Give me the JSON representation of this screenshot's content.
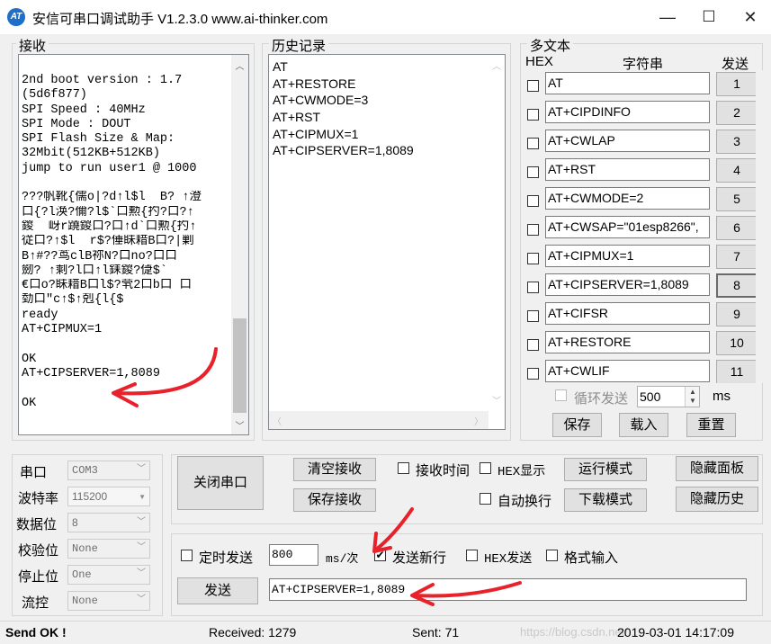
{
  "window": {
    "title": "安信可串口调试助手 V1.2.3.0    www.ai-thinker.com",
    "icon_text": "AT",
    "minimize": "—",
    "maximize": "☐",
    "close": "✕"
  },
  "receive": {
    "label": "接收",
    "lines": [
      "2nd boot version : 1.7",
      "(5d6f877)",
      "SPI Speed : 40MHz",
      "SPI Mode : DOUT",
      "SPI Flash Size & Map:",
      "32Mbit(512KB+512KB)",
      "jump to run user1 @ 1000",
      "",
      "???帆靴{儒o|?d↑l$l  B? ↑澄",
      "口{?l涣?儞?l$`口勲{扚?口?↑",
      "鍐  岈r蹺鍐口?口↑d`口勲{扚↑",
      "従口?↑$l  r$?倕眛耤B口?|剿",
      "B↑#??茑clB祢N?口no?口口",
      "劒? ↑剩?l口↑l銇鍐?偼$`",
      "€口o?眛耤B口l$?茕2口b口 口",
      "勎口\"c↑$↑剋{l{$",
      "ready",
      "AT+CIPMUX=1",
      "",
      "OK",
      "AT+CIPSERVER=1,8089",
      "",
      "OK"
    ]
  },
  "history": {
    "label": "历史记录",
    "items": [
      "AT",
      "AT+RESTORE",
      "AT+CWMODE=3",
      "AT+RST",
      "AT+CIPMUX=1",
      "AT+CIPSERVER=1,8089"
    ]
  },
  "multitext": {
    "label": "多文本",
    "col_hex": "HEX",
    "col_string": "字符串",
    "col_send": "发送",
    "rows": [
      {
        "text": "AT",
        "btn": "1"
      },
      {
        "text": "AT+CIPDINFO",
        "btn": "2"
      },
      {
        "text": "AT+CWLAP",
        "btn": "3"
      },
      {
        "text": "AT+RST",
        "btn": "4"
      },
      {
        "text": "AT+CWMODE=2",
        "btn": "5"
      },
      {
        "text": "AT+CWSAP=\"01esp8266\",",
        "btn": "6"
      },
      {
        "text": "AT+CIPMUX=1",
        "btn": "7"
      },
      {
        "text": "AT+CIPSERVER=1,8089",
        "btn": "8"
      },
      {
        "text": "AT+CIFSR",
        "btn": "9"
      },
      {
        "text": "AT+RESTORE",
        "btn": "10"
      },
      {
        "text": "AT+CWLIF",
        "btn": "11"
      }
    ],
    "loop_label": "循环发送",
    "loop_value": "500",
    "loop_unit": "ms",
    "save": "保存",
    "load": "载入",
    "reset": "重置"
  },
  "serial": {
    "port_label": "串口",
    "port_value": "COM3",
    "baud_label": "波特率",
    "baud_value": "115200",
    "databits_label": "数据位",
    "databits_value": "8",
    "parity_label": "校验位",
    "parity_value": "None",
    "stopbits_label": "停止位",
    "stopbits_value": "One",
    "flow_label": "流控",
    "flow_value": "None"
  },
  "controls": {
    "close_port": "关闭串口",
    "clear_recv": "清空接收",
    "save_recv": "保存接收",
    "recv_time": "接收时间",
    "hex_display": "HEX显示",
    "run_mode": "运行模式",
    "hide_panel": "隐藏面板",
    "auto_newline": "自动换行",
    "download_mode": "下载模式",
    "hide_history": "隐藏历史"
  },
  "send": {
    "timed_send": "定时发送",
    "interval_value": "800",
    "interval_unit": "ms/次",
    "send_newline": "发送新行",
    "hex_send": "HEX发送",
    "format_input": "格式输入",
    "send_button": "发送",
    "input_value": "AT+CIPSERVER=1,8089"
  },
  "status": {
    "message": "Send OK !",
    "received": "Received: 1279",
    "sent": "Sent: 71",
    "watermark": "https://blog.csdn.net/...",
    "datetime": "2019-03-01 14:17:09"
  }
}
